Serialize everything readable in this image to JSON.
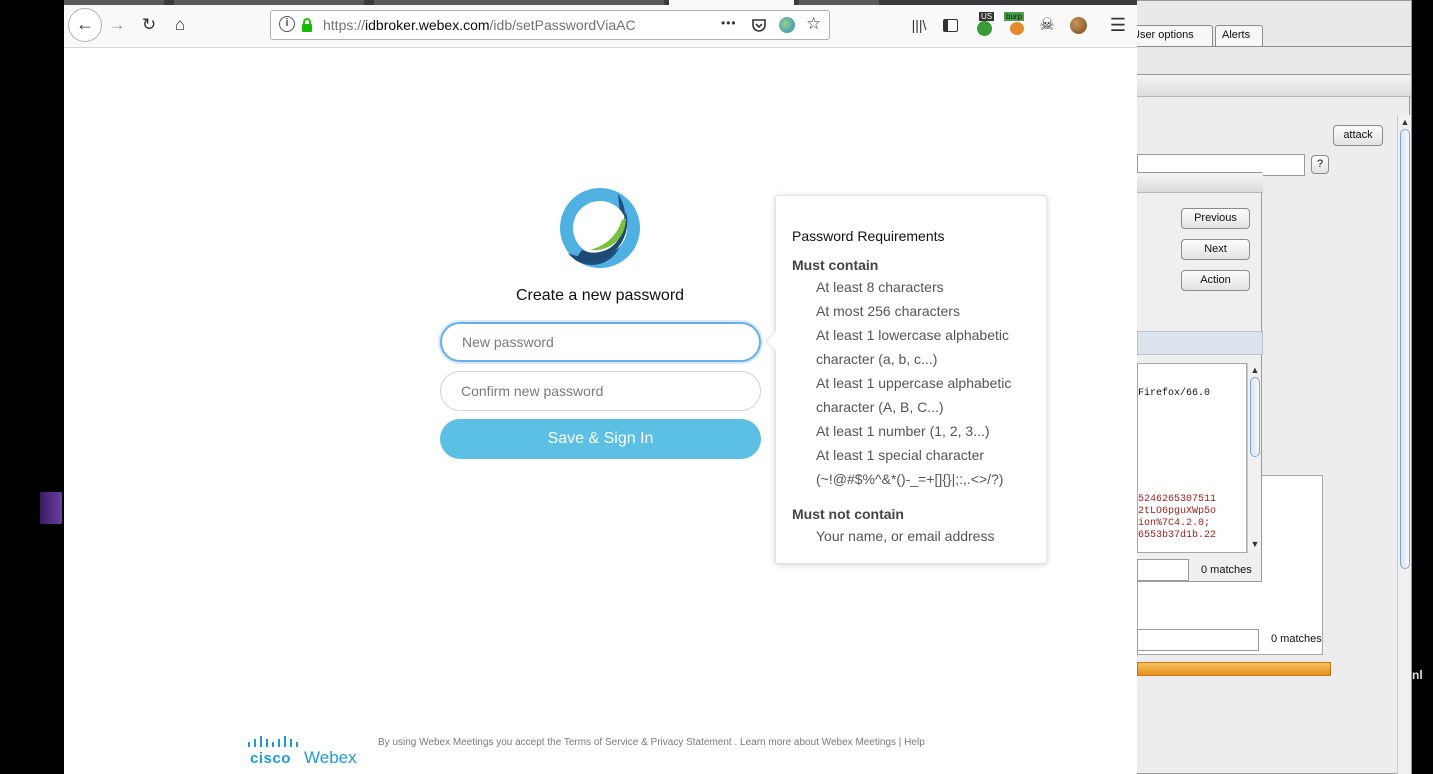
{
  "browser": {
    "url_prefix": "https://",
    "url_domain": "idbroker.webex.com",
    "url_path": "/idb/setPasswordViaAC",
    "ext_badge_us": "US",
    "ext_badge_burp": "burp",
    "more_icon": "•••"
  },
  "page": {
    "title": "Create a new password",
    "new_password_placeholder": "New password",
    "confirm_password_placeholder": "Confirm new password",
    "save_button": "Save & Sign In"
  },
  "requirements": {
    "title": "Password Requirements",
    "must_contain_heading": "Must contain",
    "must_contain": [
      "At least 8 characters",
      "At most 256 characters",
      "At least 1 lowercase alphabetic character (a, b, c...)",
      "At least 1 uppercase alphabetic character (A, B, C...)",
      "At least 1 number (1, 2, 3...)",
      "At least 1 special character (~!@#$%^&*()-_=+[]{}|;:,.<>/?)"
    ],
    "must_not_contain_heading": "Must not contain",
    "must_not_contain": [
      "Your name, or email address"
    ]
  },
  "footer": {
    "cisco": "cisco",
    "webex": "Webex",
    "text": "By using Webex Meetings you accept the Terms of Service & Privacy Statement . Learn more about Webex Meetings | Help"
  },
  "burp": {
    "tab_user_options": "User options",
    "tab_alerts": "Alerts",
    "attack_button": "attack",
    "help_button": "?",
    "previous_button": "Previous",
    "next_button": "Next",
    "action_button": "Action",
    "request_line": "Firefox/66.0",
    "hex_lines": [
      "5246265307511",
      "2tLO6pguXWp5o",
      "ion%7C4.2.0;",
      "6553b37d1b.22"
    ],
    "matches_1": "0 matches",
    "matches_2": "0 matches",
    "edge_text": "nl"
  },
  "colors": {
    "accent": "#5bc0e3",
    "cisco_blue": "#1e9bd7",
    "burp_orange": "#f0a030"
  }
}
